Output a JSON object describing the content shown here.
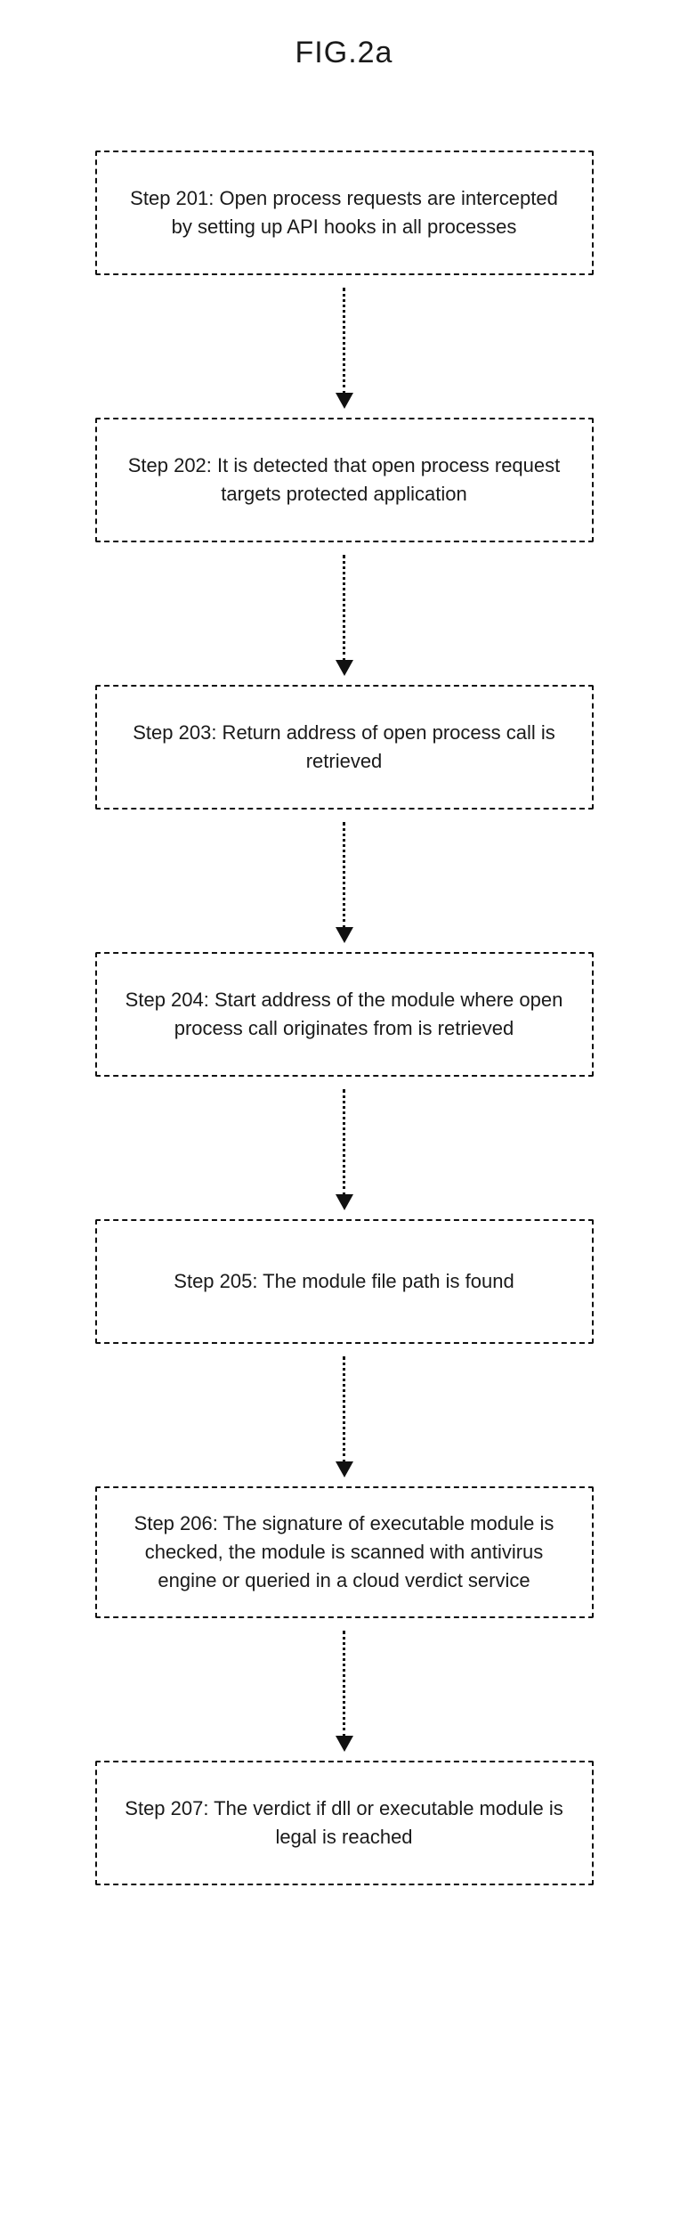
{
  "figure_title": "FIG.2a",
  "steps": [
    {
      "text": "Step 201: Open process requests  are intercepted by setting up API hooks in all processes"
    },
    {
      "text": "Step 202: It is detected that open process request targets protected application"
    },
    {
      "text": "Step 203: Return address of open process call is retrieved"
    },
    {
      "text": "Step 204:  Start address of the module where open process call originates from is retrieved"
    },
    {
      "text": "Step 205: The module file path is found"
    },
    {
      "text": "Step 206: The signature of executable module is checked, the module is scanned with antivirus engine or queried in a cloud verdict service"
    },
    {
      "text": "Step 207: The verdict if dll or executable module is legal is reached"
    }
  ]
}
